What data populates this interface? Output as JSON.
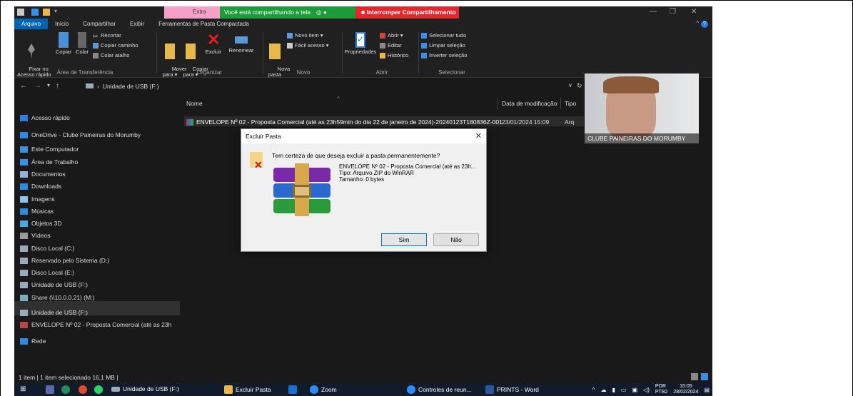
{
  "titlebar": {
    "extra_tab": "Extra",
    "sharing_msg": "Você está compartilhando a tela",
    "stop_sharing": "Interromper Compartilhamento"
  },
  "ribbon_tabs": [
    "Arquivo",
    "Início",
    "Compartilhar",
    "Exibir",
    "Ferramentas de Pasta Compactada"
  ],
  "ribbon": {
    "pin": "Fixar no\nAcesso rápido",
    "copy": "Copiar",
    "paste": "Colar",
    "cut": "Recortar",
    "copy_path": "Copiar caminho",
    "paste_shortcut": "Colar atalho",
    "group_clipboard": "Área de Transferência",
    "move_to": "Mover\npara ▾",
    "copy_to": "Copiar\npara ▾",
    "delete": "Excluir",
    "rename": "Renomear",
    "group_organize": "Organizar",
    "new_folder": "Nova\npasta",
    "new_item": "Novo item ▾",
    "easy_access": "Fácil acesso ▾",
    "group_new": "Novo",
    "properties": "Propriedades",
    "open": "Abrir ▾",
    "edit": "Editar",
    "history": "Histórico",
    "group_open": "Abrir",
    "select_all": "Selecionar tudo",
    "select_none": "Limpar seleção",
    "invert_selection": "Inverter seleção",
    "group_select": "Selecionar"
  },
  "address": {
    "path": "Unidade de USB (F:)"
  },
  "sidebar": [
    {
      "label": "Acesso rápido",
      "icon": "star-icon",
      "color": "#2a7be4"
    },
    {
      "label": "OneDrive - Clube Paineiras do Morumby",
      "icon": "cloud-icon",
      "color": "#2a8be4"
    },
    {
      "label": "Este Computador",
      "icon": "computer-icon",
      "color": "#3a8ee6"
    },
    {
      "label": "Área de Trabalho",
      "icon": "desktop-icon",
      "color": "#3a8ee6"
    },
    {
      "label": "Documentos",
      "icon": "documents-icon",
      "color": "#8fb3d9"
    },
    {
      "label": "Downloads",
      "icon": "download-icon",
      "color": "#2a8be4"
    },
    {
      "label": "Imagens",
      "icon": "images-icon",
      "color": "#8fc3ea"
    },
    {
      "label": "Músicas",
      "icon": "music-icon",
      "color": "#2a8be4"
    },
    {
      "label": "Objetos 3D",
      "icon": "cube-icon",
      "color": "#4aa8e8"
    },
    {
      "label": "Vídeos",
      "icon": "video-icon",
      "color": "#999"
    },
    {
      "label": "Disco Local (C:)",
      "icon": "drive-icon",
      "color": "#9ab"
    },
    {
      "label": "Reservado pelo Sistema (D:)",
      "icon": "drive-icon",
      "color": "#9ab"
    },
    {
      "label": "Disco Local (E:)",
      "icon": "drive-icon",
      "color": "#9ab"
    },
    {
      "label": "Unidade de USB (F:)",
      "icon": "usb-drive-icon",
      "color": "#9ab"
    },
    {
      "label": "Share (\\\\10.0.0.21) (M:)",
      "icon": "network-drive-icon",
      "color": "#7ab"
    },
    {
      "label": "Unidade de USB (F:)",
      "icon": "usb-drive-icon",
      "color": "#9ab"
    },
    {
      "label": "ENVELOPE Nº 02 - Proposta Comercial (até as 23h",
      "icon": "winrar-icon",
      "color": "#b44"
    },
    {
      "label": "Rede",
      "icon": "network-icon",
      "color": "#2a8be4"
    }
  ],
  "columns": {
    "name": "Nome",
    "date": "Data de modificação",
    "type": "Tipo"
  },
  "file": {
    "name": "ENVELOPE Nº 02 - Proposta Comercial (até as 23h59min do dia 22 de janeiro de 2024)-20240123T180836Z-001",
    "date": "23/01/2024 15:09",
    "type": "Arq"
  },
  "dialog": {
    "title": "Excluir Pasta",
    "question": "Tem certeza de que deseja excluir a pasta permanentemente?",
    "info_name": "ENVELOPE Nº 02 - Proposta Comercial (até as 23h...",
    "info_type": "Tipo: Arquivo ZIP do WinRAR",
    "info_size": "Tamanho: 0 bytes",
    "yes": "Sim",
    "no": "Não"
  },
  "webcam": {
    "label": "CLUBE PAINEIRAS DO MORUMBY"
  },
  "status": {
    "text": "1 item  |  1 item selecionado  16,1 MB  |"
  },
  "taskbar": {
    "items": [
      "Unidade de USB (F:)",
      "Excluir Pasta",
      "Zoom",
      "Controles de reun...",
      "PRINTS - Word"
    ],
    "lang": "POR",
    "lang2": "PTB2",
    "time": "15:05",
    "date": "28/02/2024"
  }
}
